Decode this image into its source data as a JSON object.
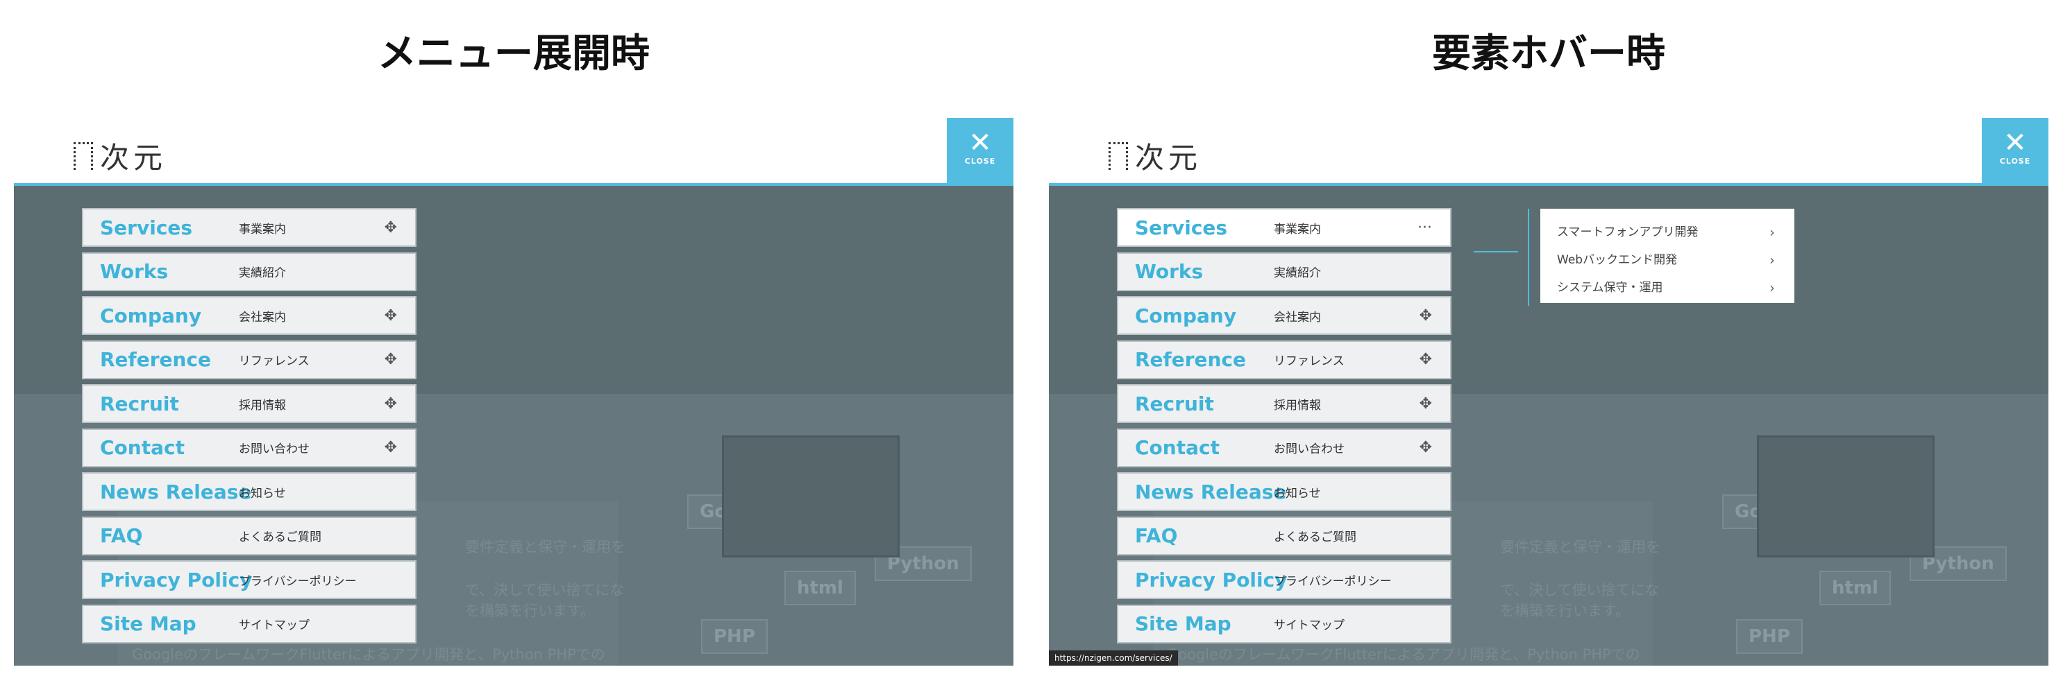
{
  "titles": {
    "left": "メニュー展開時",
    "right": "要素ホバー時"
  },
  "header": {
    "logo_text": "次元",
    "close_label": "CLOSE",
    "close_glyph": "✕"
  },
  "menu": [
    {
      "en": "Services",
      "ja": "事業案内",
      "indicator": "move-icon",
      "glyph": "✥"
    },
    {
      "en": "Works",
      "ja": "実績紹介",
      "indicator": "",
      "glyph": ""
    },
    {
      "en": "Company",
      "ja": "会社案内",
      "indicator": "move-icon",
      "glyph": "✥"
    },
    {
      "en": "Reference",
      "ja": "リファレンス",
      "indicator": "move-icon",
      "glyph": "✥"
    },
    {
      "en": "Recruit",
      "ja": "採用情報",
      "indicator": "move-icon",
      "glyph": "✥"
    },
    {
      "en": "Contact",
      "ja": "お問い合わせ",
      "indicator": "move-icon",
      "glyph": "✥"
    },
    {
      "en": "News Release",
      "ja": "お知らせ",
      "indicator": "",
      "glyph": ""
    },
    {
      "en": "FAQ",
      "ja": "よくあるご質問",
      "indicator": "",
      "glyph": ""
    },
    {
      "en": "Privacy Policy",
      "ja": "プライバシーポリシー",
      "indicator": "",
      "glyph": ""
    },
    {
      "en": "Site Map",
      "ja": "サイトマップ",
      "indicator": "",
      "glyph": ""
    }
  ],
  "hover_indicator": {
    "icon": "ellipsis-icon",
    "glyph": "···"
  },
  "submenu": [
    {
      "label": "スマートフォンアプリ開発",
      "chevron": "›"
    },
    {
      "label": "Webバックエンド開発",
      "chevron": "›"
    },
    {
      "label": "システム保守・運用",
      "chevron": "›"
    }
  ],
  "background": {
    "text1": "要件定義と保守・運用を",
    "text2": "で、決して使い捨てにな",
    "text3": "を構築を行います。",
    "text4": "GoogleのフレームワークFlutterによるアプリ開発と、Python PHPでの",
    "card1": "Go",
    "card2": "Python",
    "card3": "PHP",
    "card4": "html"
  },
  "status_url": "https://nzigen.com/services/",
  "colors": {
    "accent": "#52bde1",
    "overlay": "#5c6d72",
    "menu_bg": "#eef0f1"
  }
}
